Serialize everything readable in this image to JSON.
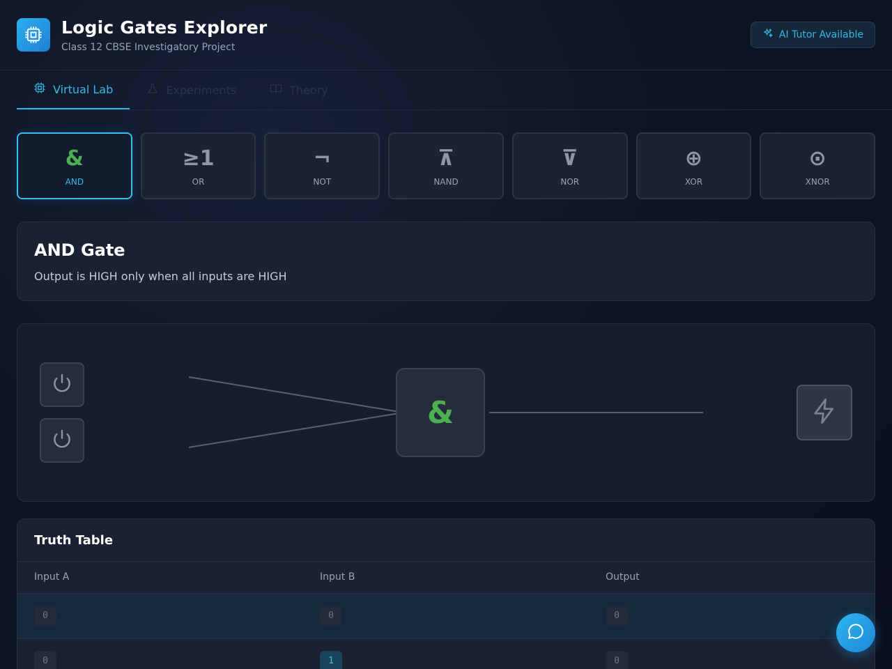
{
  "header": {
    "title": "Logic Gates Explorer",
    "subtitle": "Class 12 CBSE Investigatory Project",
    "logo_icon": "chip-icon",
    "tutor_label": "AI Tutor Available",
    "tutor_icon": "sparkles-icon"
  },
  "tabs": [
    {
      "label": "Virtual Lab",
      "icon": "chip-icon",
      "active": true
    },
    {
      "label": "Experiments",
      "icon": "flask-icon",
      "active": false
    },
    {
      "label": "Theory",
      "icon": "book-icon",
      "active": false
    }
  ],
  "gates": [
    {
      "symbol": "&",
      "label": "AND",
      "active": true
    },
    {
      "symbol": "≥1",
      "label": "OR",
      "active": false
    },
    {
      "symbol": "¬",
      "label": "NOT",
      "active": false
    },
    {
      "symbol": "⊼",
      "label": "NAND",
      "active": false
    },
    {
      "symbol": "⊽",
      "label": "NOR",
      "active": false
    },
    {
      "symbol": "⊕",
      "label": "XOR",
      "active": false
    },
    {
      "symbol": "⊙",
      "label": "XNOR",
      "active": false
    }
  ],
  "info": {
    "title": "AND Gate",
    "description": "Output is HIGH only when all inputs are HIGH"
  },
  "circuit": {
    "gate_symbol": "&",
    "input_a_icon": "power-icon",
    "input_b_icon": "power-icon",
    "output_icon": "lightning-icon"
  },
  "truth_table": {
    "title": "Truth Table",
    "headers": [
      "Input A",
      "Input B",
      "Output"
    ],
    "rows": [
      [
        "0",
        "0",
        "0"
      ],
      [
        "0",
        "1",
        "0"
      ]
    ]
  },
  "colors": {
    "accent": "#35b8e6",
    "gate_green": "#4caf50",
    "background": "#0e1424"
  },
  "chat_icon": "chat-bubble-icon"
}
